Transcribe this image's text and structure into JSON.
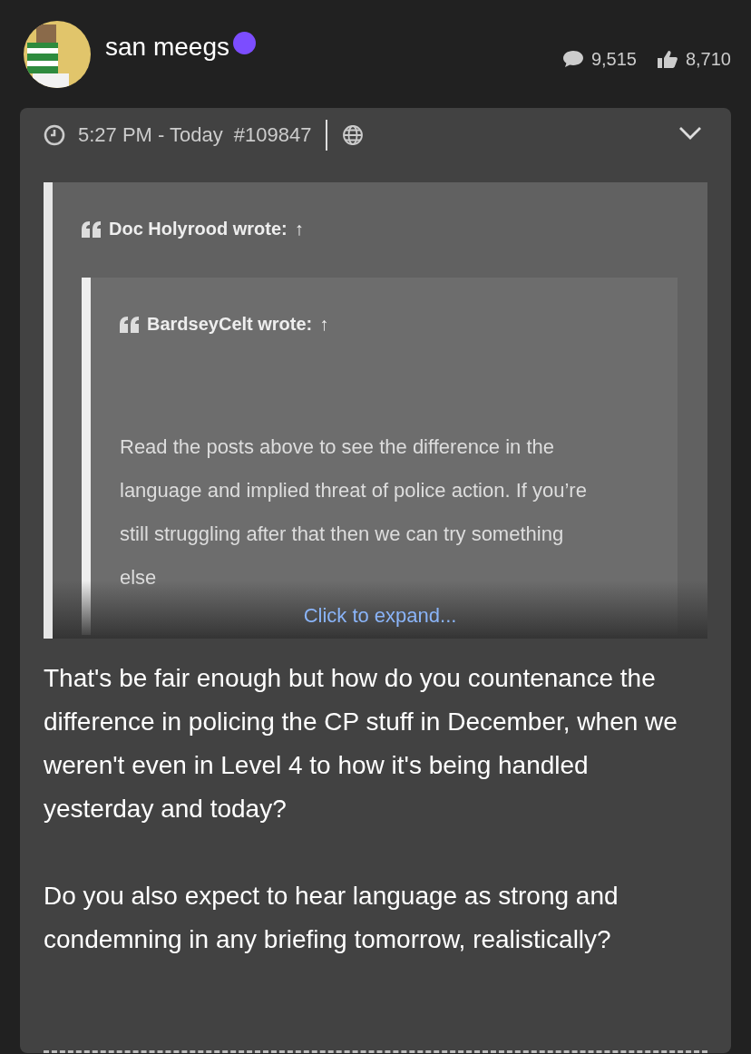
{
  "user": {
    "name": "san meegs",
    "online": true
  },
  "stats": [
    {
      "kind": "posts",
      "value": "9,515"
    },
    {
      "kind": "likes",
      "value": "8,710"
    }
  ],
  "post": {
    "time": "5:27 PM - Today",
    "number": "#109847"
  },
  "quote": {
    "author": "Doc Holyrood wrote:",
    "arrow": "↑",
    "quote": {
      "author": "BardseyCelt wrote:",
      "arrow": "↑",
      "text": "Read the posts above to see the difference in the language and implied threat of police action. If you’re still struggling after that then we can try something else",
      "expand": "Click to expand..."
    }
  },
  "body": [
    "That's be fair enough but how do you countenance the difference in policing the CP stuff in December, when we weren't even in Level 4 to how it's being handled yesterday and today?",
    "Do you also expect to hear language as strong and condemning in any briefing tomorrow, realistically?"
  ]
}
